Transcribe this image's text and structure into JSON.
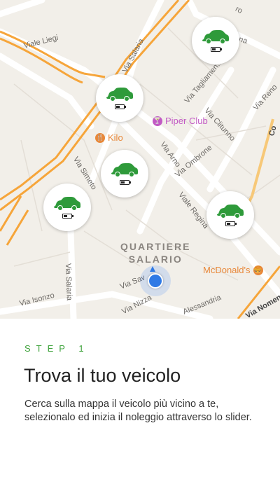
{
  "colors": {
    "accent": "#3fa33c",
    "car": "#2e9a3a",
    "user_location": "#2f7ae5",
    "major_road": "#f6a53a",
    "poi_pink": "#c25ac4",
    "poi_orange": "#e8883a"
  },
  "map": {
    "streets": {
      "viale_liegi": "Viale Liegi",
      "via_salaria_top": "Via Salaria",
      "via_chiana": "Via Chiana",
      "via_tagliamento": "Via Tagliamen.o",
      "via_clitunno": "Via Clitunno",
      "via_reno": "Via Reno",
      "via_arno": "Via Arno",
      "via_ombrone": "Via Ombrone",
      "via_simeto": "Via Simeto",
      "viale_regina": "Viale Regina",
      "via_salaria_left": "Via Salaria",
      "via_isonzo": "Via Isonzo",
      "via_nizza": "Via Nizza",
      "via_savoia": "Via Sav",
      "via_alessandria": "Alessandria",
      "via_nomentana": "Via Noment",
      "corso": "Co",
      "via_top": "ro"
    },
    "district_line1": "QUARTIERE",
    "district_line2": "SALARIO",
    "pois": {
      "piper": "Piper Club",
      "kilo": "Kilo",
      "mcdonalds": "McDonald's"
    },
    "cars": [
      {
        "icon": "car-icon",
        "battery_level": 0.5
      },
      {
        "icon": "car-icon",
        "battery_level": 0.5
      },
      {
        "icon": "car-icon",
        "battery_level": 0.5
      },
      {
        "icon": "car-icon",
        "battery_level": 0.5
      },
      {
        "icon": "car-icon",
        "battery_level": 0.5
      }
    ]
  },
  "onboarding": {
    "step": "STEP 1",
    "title": "Trova il tuo veicolo",
    "description": "Cerca sulla mappa il veicolo più vicino a te, selezionalo ed inizia il noleggio attraverso lo slider."
  }
}
